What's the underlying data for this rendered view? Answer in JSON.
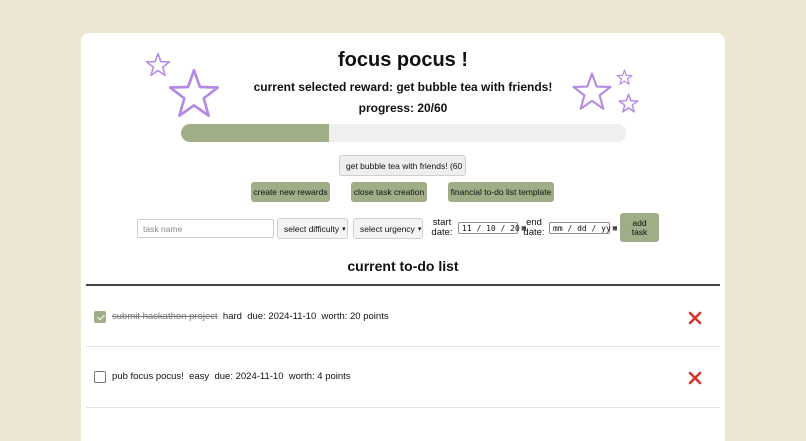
{
  "app": {
    "title": "focus pocus !",
    "reward_line": "current selected reward: get bubble tea with friends!",
    "progress_line": "progress: 20/60",
    "progress": {
      "current": 20,
      "total": 60
    }
  },
  "controls": {
    "reward_select_value": "get bubble tea with friends! (60",
    "buttons": {
      "create_rewards": "create new rewards",
      "close_task_creation": "close task creation",
      "financial_template": "financial to-do list template"
    }
  },
  "task_form": {
    "task_name_placeholder": "task name",
    "difficulty_value": "select difficulty",
    "urgency_value": "select urgency",
    "start_label_1": "start",
    "start_label_2": "date:",
    "start_value": "11 / 10 / 20",
    "end_label_1": "end",
    "end_label_2": "date:",
    "end_value": "mm / dd / yy",
    "add_label_1": "add",
    "add_label_2": "task"
  },
  "list": {
    "title": "current to-do list",
    "items": [
      {
        "name": "submit hackathon project",
        "difficulty": "hard",
        "due": "due: 2024-11-10",
        "worth": "worth: 20 points",
        "completed": true
      },
      {
        "name": "pub focus pocus!",
        "difficulty": "easy",
        "due": "due: 2024-11-10",
        "worth": "worth: 4 points",
        "completed": false
      }
    ]
  },
  "colors": {
    "background": "#ede6d2",
    "accent_green": "#9fae86",
    "star_purple": "#b48ae6",
    "delete_red": "#d9342b"
  },
  "icons": [
    "star-icon",
    "chevron-down-icon",
    "calendar-icon",
    "delete-icon",
    "checkbox-icon"
  ]
}
